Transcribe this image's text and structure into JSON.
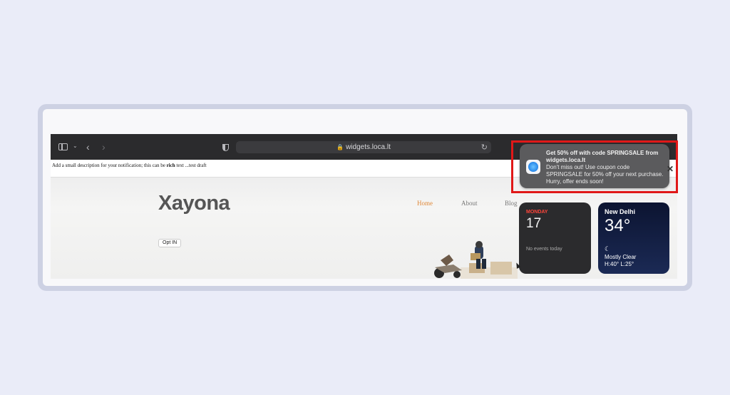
{
  "browser": {
    "url": "widgets.loca.lt",
    "description_prefix": "Add a small description for your notification; this can be",
    "description_bold": "rich",
    "description_suffix": "text ...test draft"
  },
  "site": {
    "logo": "Xayona",
    "nav": [
      "Home",
      "About",
      "Blog"
    ],
    "active_nav": "Home",
    "optin_label": "Opt IN"
  },
  "notification": {
    "title": "Get 50% off with code SPRINGSALE from widgets.loca.lt",
    "body": "Don't miss out! Use coupon code SPRINGSALE for 50% off your next purchase. Hurry, offer ends soon!",
    "close_symbol": "✕"
  },
  "calendar_widget": {
    "day": "MONDAY",
    "date": "17",
    "events": "No events today"
  },
  "weather_widget": {
    "city": "New Delhi",
    "temperature": "34°",
    "condition": "Mostly Clear",
    "high_low": "H:40° L:25°"
  },
  "colors": {
    "accent_nav": "#e0893a",
    "highlight": "#e01818"
  }
}
